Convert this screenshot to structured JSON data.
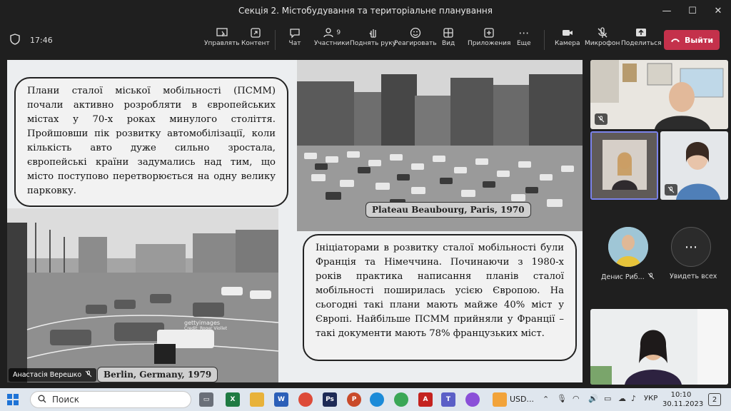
{
  "window": {
    "title": "Секція 2. Містобудування та територіальне планування",
    "controls": [
      "—",
      "☐",
      "✕"
    ]
  },
  "toolbar": {
    "time": "17:46",
    "items": [
      {
        "label": "Управлять",
        "icon": "share-screen-icon"
      },
      {
        "label": "Контент",
        "icon": "content-icon"
      },
      {
        "label": "Чат",
        "icon": "chat-icon"
      },
      {
        "label": "Участники",
        "icon": "people-icon",
        "count": "9"
      },
      {
        "label": "Поднять руку",
        "icon": "raise-hand-icon"
      },
      {
        "label": "Реагировать",
        "icon": "react-icon"
      },
      {
        "label": "Вид",
        "icon": "view-icon"
      },
      {
        "label": "Приложения",
        "icon": "apps-icon"
      },
      {
        "label": "Еще",
        "icon": "more-icon"
      },
      {
        "label": "Камера",
        "icon": "camera-icon"
      },
      {
        "label": "Микрофон",
        "icon": "mic-off-icon"
      },
      {
        "label": "Поделиться",
        "icon": "share-icon"
      }
    ],
    "leave_label": "Выйти",
    "leave_color": "#c4314b"
  },
  "slide": {
    "text1": "Плани сталої міської мобільності (ПСММ) почали активно розробляти в європейських містах у 70-х роках минулого століття. Пройшовши пік розвитку автомобілізації, коли кількість авто дуже сильно зростала, європейські країни задумались над тим, що місто поступово перетворюється на одну велику парковку.",
    "caption_paris": "Plateau Beaubourg, Paris, 1970",
    "text2": "Ініціаторами в розвитку сталої мобільності були Франція та Німеччина. Починаючи з 1980-х років практика написання планів сталої мобільності поширилась усією Європою. На сьогодні такі плани мають майже 40% міст у Європі. Найбільше ПСММ прийняли у Франції – такі документи мають 78% французьких міст.",
    "caption_berlin": "Berlin, Germany, 1979",
    "watermark": "gettyimages",
    "watermark_credit": "Credit: Roger Viollet",
    "presenter": "Анастасія Верешко"
  },
  "participants": {
    "denys_name": "Денис Риб...",
    "see_all": "Увидеть всех"
  },
  "taskbar": {
    "search_placeholder": "Поиск",
    "usd_label": "USD...",
    "lang": "УКР",
    "time": "10:10",
    "date": "30.11.2023",
    "notif_count": "2"
  }
}
